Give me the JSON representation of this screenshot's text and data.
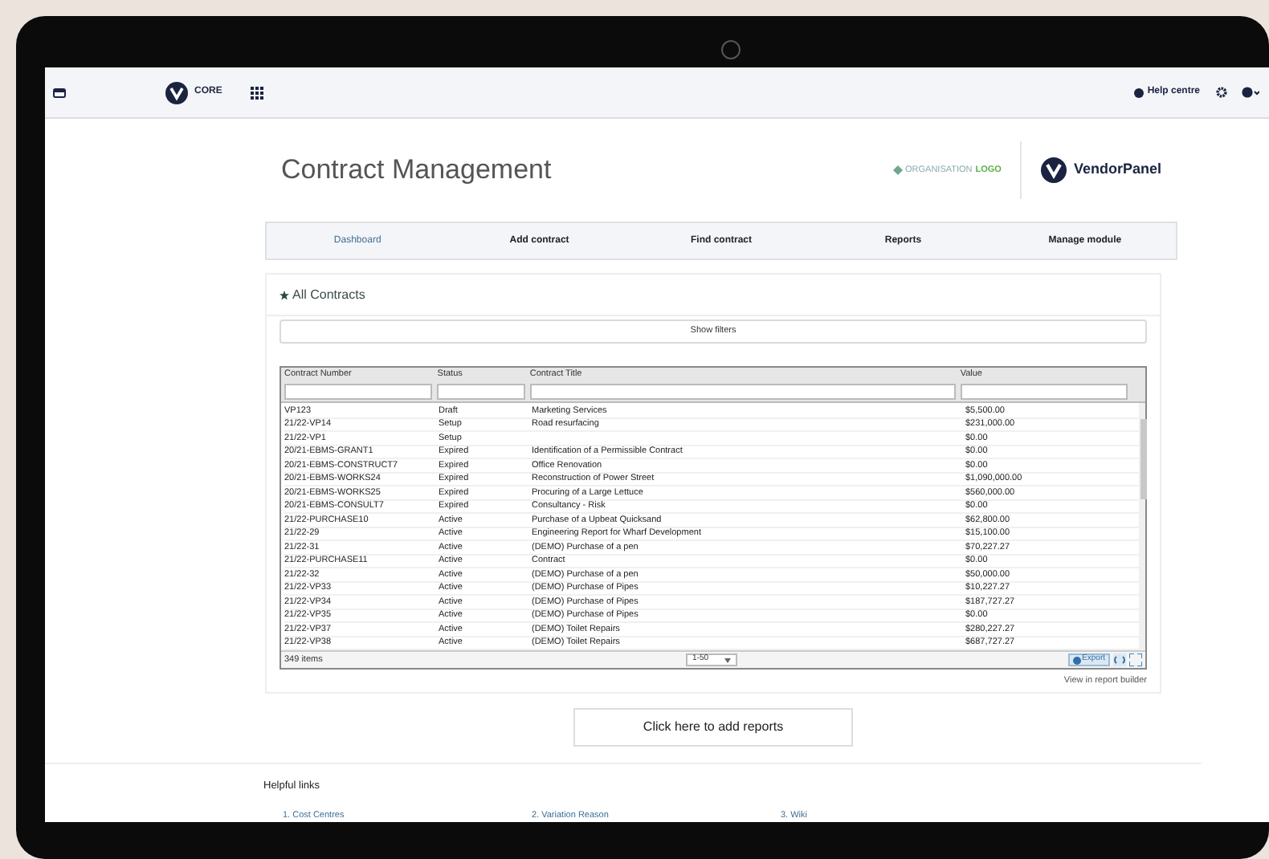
{
  "top_bar": {
    "product": "CORE",
    "help": "Help centre"
  },
  "header": {
    "title": "Contract Management",
    "org_logo": [
      "ORGANISATION",
      "LOGO"
    ],
    "brand": "VendorPanel"
  },
  "tabs": [
    {
      "label": "Dashboard",
      "selected": true
    },
    {
      "label": "Add contract",
      "selected": false
    },
    {
      "label": "Find contract",
      "selected": false
    },
    {
      "label": "Reports",
      "selected": false
    },
    {
      "label": "Manage module",
      "selected": false
    }
  ],
  "panel": {
    "title": "All Contracts",
    "show_filters": "Show filters",
    "table": {
      "columns": [
        "Contract Number",
        "Status",
        "Contract Title",
        "Value"
      ],
      "rows": [
        [
          "VP123",
          "Draft",
          "Marketing Services",
          "$5,500.00"
        ],
        [
          "21/22-VP14",
          "Setup",
          "Road resurfacing",
          "$231,000.00"
        ],
        [
          "21/22-VP1",
          "Setup",
          "",
          "$0.00"
        ],
        [
          "20/21-EBMS-GRANT1",
          "Expired",
          "Identification of a Permissible Contract",
          "$0.00"
        ],
        [
          "20/21-EBMS-CONSTRUCT7",
          "Expired",
          "Office Renovation",
          "$0.00"
        ],
        [
          "20/21-EBMS-WORKS24",
          "Expired",
          "Reconstruction of Power Street",
          "$1,090,000.00"
        ],
        [
          "20/21-EBMS-WORKS25",
          "Expired",
          "Procuring of a Large Lettuce",
          "$560,000.00"
        ],
        [
          "20/21-EBMS-CONSULT7",
          "Expired",
          "Consultancy - Risk",
          "$0.00"
        ],
        [
          "21/22-PURCHASE10",
          "Active",
          "Purchase of a Upbeat Quicksand",
          "$62,800.00"
        ],
        [
          "21/22-29",
          "Active",
          "Engineering Report for Wharf Development",
          "$15,100.00"
        ],
        [
          "21/22-31",
          "Active",
          "(DEMO) Purchase of a pen",
          "$70,227.27"
        ],
        [
          "21/22-PURCHASE11",
          "Active",
          "Contract",
          "$0.00"
        ],
        [
          "21/22-32",
          "Active",
          "(DEMO) Purchase of a pen",
          "$50,000.00"
        ],
        [
          "21/22-VP33",
          "Active",
          "(DEMO) Purchase of Pipes",
          "$10,227.27"
        ],
        [
          "21/22-VP34",
          "Active",
          "(DEMO) Purchase of Pipes",
          "$187,727.27"
        ],
        [
          "21/22-VP35",
          "Active",
          "(DEMO) Purchase of Pipes",
          "$0.00"
        ],
        [
          "21/22-VP37",
          "Active",
          "(DEMO) Toilet Repairs",
          "$280,227.27"
        ],
        [
          "21/22-VP38",
          "Active",
          "(DEMO) Toilet Repairs",
          "$687,727.27"
        ]
      ]
    },
    "item_count": "349 items",
    "pager": "1-50",
    "export": "Export",
    "report_link": "View in report builder"
  },
  "add_reports": "Click here to add reports",
  "helpful_links": {
    "title": "Helpful links",
    "links": [
      "1. Cost Centres",
      "2. Variation Reason",
      "3. Wiki"
    ]
  }
}
